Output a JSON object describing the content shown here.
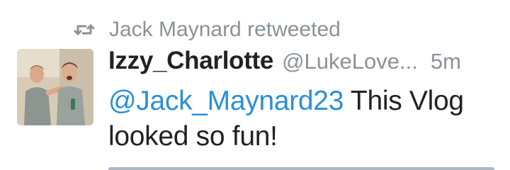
{
  "retweet": {
    "icon": "retweet-icon",
    "text": "Jack Maynard retweeted"
  },
  "tweet": {
    "avatar_icon": "profile-photo",
    "display_name": "Izzy_Charlotte",
    "handle": "@LukeLove...",
    "timestamp": "5m",
    "mention": "@Jack_Maynard23",
    "body": " This Vlog looked so fun!"
  },
  "colors": {
    "mention": "#2b8fd6",
    "muted": "#8a9299",
    "text": "#222222"
  }
}
